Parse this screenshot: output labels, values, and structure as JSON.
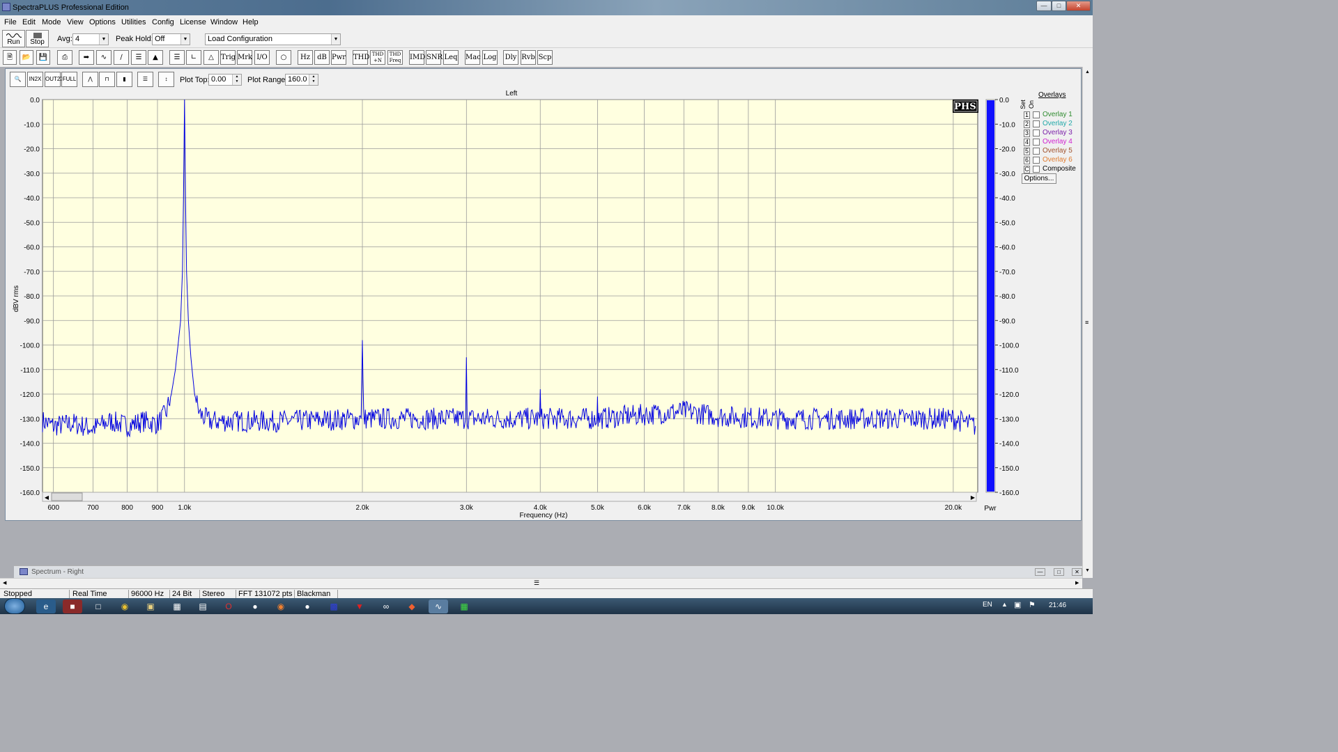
{
  "window": {
    "title": "SpectraPLUS Professional Edition"
  },
  "menu": [
    "File",
    "Edit",
    "Mode",
    "View",
    "Options",
    "Utilities",
    "Config",
    "License",
    "Window",
    "Help"
  ],
  "toolbar": {
    "run_label": "Run",
    "stop_label": "Stop",
    "avg_label": "Avg:",
    "avg_value": "4",
    "peak_hold_label": "Peak Hold:",
    "peak_hold_value": "Off",
    "config_value": "Load Configuration"
  },
  "toolbar2_buttons": [
    "Trig",
    "Mrk",
    "I/O",
    "Hz",
    "dB",
    "Pwr",
    "THD",
    "THD +N",
    "THD Freq",
    "IMD",
    "SNR",
    "Leq",
    "Mac",
    "Log",
    "Dly",
    "Rvb",
    "Scp"
  ],
  "plot_toolbar": {
    "plot_top_label": "Plot Top:",
    "plot_top_value": "0.00",
    "plot_range_label": "Plot Range:",
    "plot_range_value": "160.0"
  },
  "overlays": {
    "header": "Overlays",
    "col_set": "Set",
    "col_on": "On",
    "items": [
      {
        "num": "1",
        "name": "Overlay 1",
        "color": "#2e8b2e"
      },
      {
        "num": "2",
        "name": "Overlay 2",
        "color": "#1fa8a8"
      },
      {
        "num": "3",
        "name": "Overlay 3",
        "color": "#7a1fa8"
      },
      {
        "num": "4",
        "name": "Overlay 4",
        "color": "#d020d0"
      },
      {
        "num": "5",
        "name": "Overlay 5",
        "color": "#a0522d"
      },
      {
        "num": "6",
        "name": "Overlay 6",
        "color": "#e07b2e"
      },
      {
        "num": "C",
        "name": "Composite",
        "color": "#000000"
      }
    ],
    "options_label": "Options..."
  },
  "chart_data": {
    "type": "line",
    "title": "Left",
    "xlabel": "Frequency (Hz)",
    "ylabel": "dBV rms",
    "x_scale": "log",
    "xlim": [
      575,
      22000
    ],
    "ylim": [
      -160,
      0
    ],
    "x_ticks": [
      600,
      700,
      800,
      900,
      1000,
      2000,
      3000,
      4000,
      5000,
      6000,
      7000,
      8000,
      9000,
      10000,
      20000
    ],
    "x_tick_labels": [
      "600",
      "700",
      "800",
      "900",
      "1.0k",
      "2.0k",
      "3.0k",
      "4.0k",
      "5.0k",
      "6.0k",
      "7.0k",
      "8.0k",
      "9.0k",
      "10.0k",
      "20.0k"
    ],
    "y_ticks": [
      0,
      -10,
      -20,
      -30,
      -40,
      -50,
      -60,
      -70,
      -80,
      -90,
      -100,
      -110,
      -120,
      -130,
      -140,
      -150,
      -160
    ],
    "y_tick_labels": [
      "0.0",
      "-10.0",
      "-20.0",
      "-30.0",
      "-40.0",
      "-50.0",
      "-60.0",
      "-70.0",
      "-80.0",
      "-90.0",
      "-100.0",
      "-110.0",
      "-120.0",
      "-130.0",
      "-140.0",
      "-150.0",
      "-160.0"
    ],
    "grid": true,
    "logo_text": "PHS",
    "bar_label": "Pwr",
    "power_level_db": 0,
    "noise_floor_db": -131,
    "series": [
      {
        "color": "#0000e0",
        "points": [
          [
            575,
            -131
          ],
          [
            600,
            -133
          ],
          [
            650,
            -132
          ],
          [
            700,
            -134
          ],
          [
            750,
            -131
          ],
          [
            800,
            -133
          ],
          [
            850,
            -131
          ],
          [
            900,
            -132
          ],
          [
            930,
            -128
          ],
          [
            950,
            -120
          ],
          [
            965,
            -110
          ],
          [
            975,
            -100
          ],
          [
            985,
            -90
          ],
          [
            992,
            -70
          ],
          [
            996,
            -40
          ],
          [
            1000,
            0
          ],
          [
            1004,
            -40
          ],
          [
            1008,
            -70
          ],
          [
            1015,
            -90
          ],
          [
            1025,
            -105
          ],
          [
            1040,
            -120
          ],
          [
            1060,
            -128
          ],
          [
            1100,
            -131
          ],
          [
            1500,
            -131
          ],
          [
            1990,
            -130
          ],
          [
            2000,
            -98
          ],
          [
            2010,
            -130
          ],
          [
            2990,
            -130
          ],
          [
            3000,
            -105
          ],
          [
            3010,
            -130
          ],
          [
            3990,
            -130
          ],
          [
            4000,
            -118
          ],
          [
            4010,
            -130
          ],
          [
            4990,
            -130
          ],
          [
            5000,
            -121
          ],
          [
            5010,
            -130
          ],
          [
            7000,
            -127
          ],
          [
            8000,
            -129
          ],
          [
            10000,
            -130
          ],
          [
            15000,
            -130
          ],
          [
            20000,
            -130
          ],
          [
            21800,
            -133
          ]
        ]
      }
    ]
  },
  "bottom_window": {
    "title": "Spectrum - Right"
  },
  "status": [
    "Stopped",
    "Real Time",
    "96000 Hz",
    "24 Bit",
    "Stereo",
    "FFT 131072 pts",
    "Blackman"
  ],
  "taskbar": {
    "lang": "EN",
    "clock": "21:46"
  }
}
